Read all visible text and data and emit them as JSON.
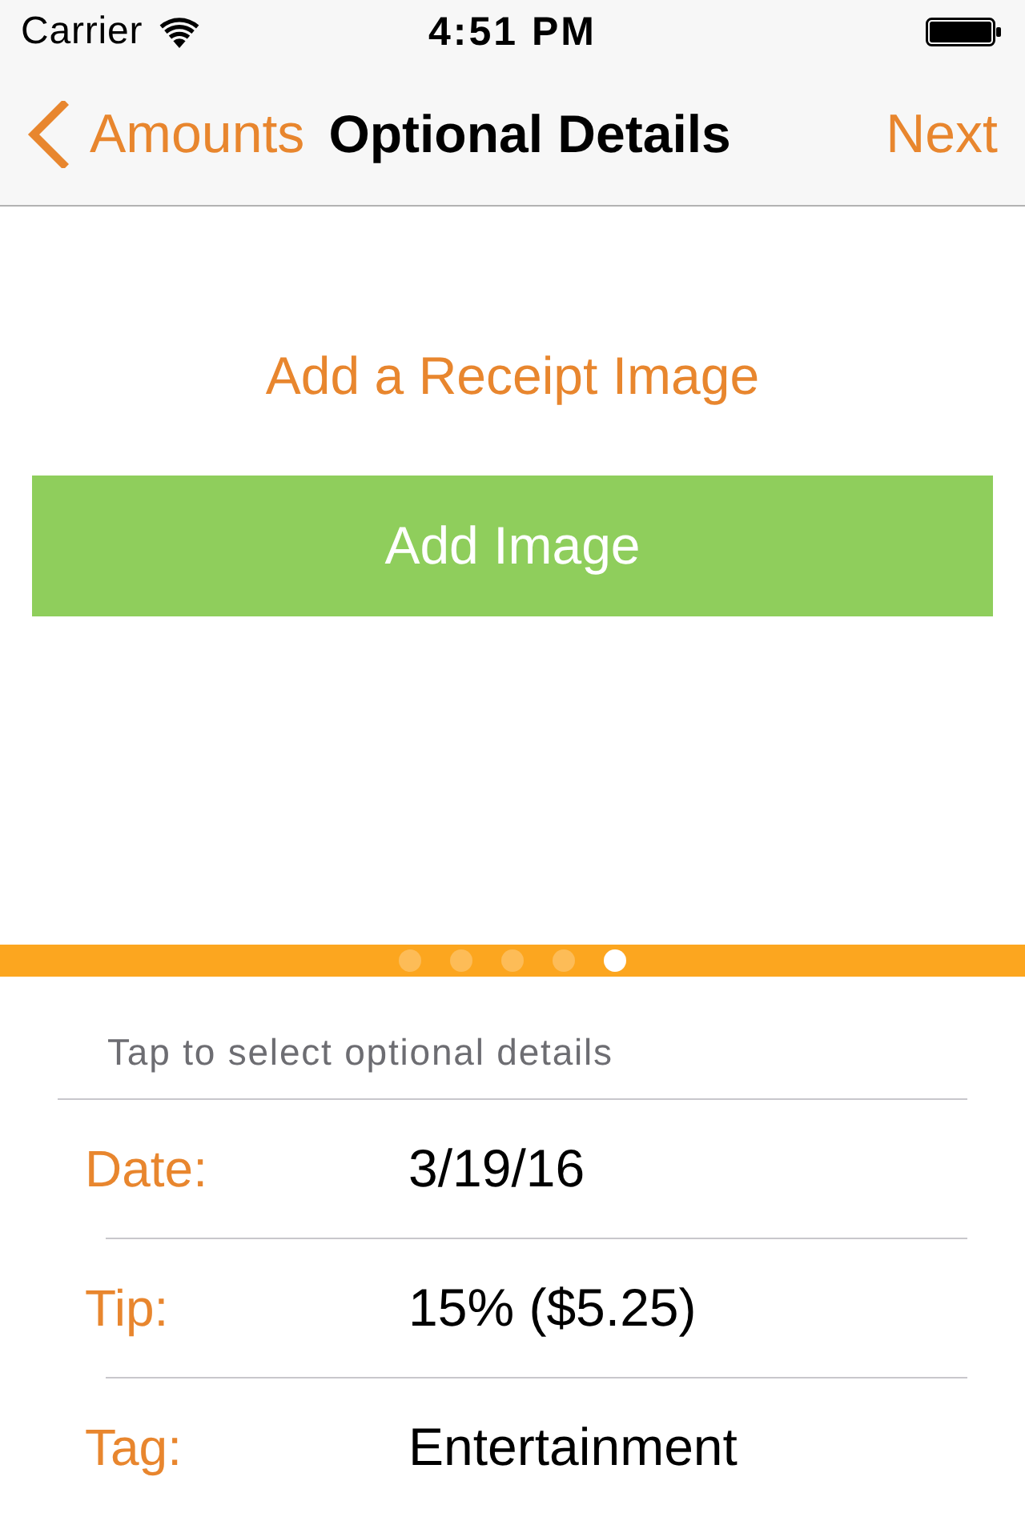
{
  "status_bar": {
    "carrier": "Carrier",
    "time": "4:51 PM"
  },
  "nav_bar": {
    "back": "Amounts",
    "title": "Optional Details",
    "next": "Next"
  },
  "receipt": {
    "heading": "Add a Receipt Image",
    "button": "Add Image"
  },
  "page_control": {
    "pages": [
      {
        "selected": false
      },
      {
        "selected": false
      },
      {
        "selected": false
      },
      {
        "selected": false
      },
      {
        "selected": true
      }
    ]
  },
  "details": {
    "hint": "Tap to select optional details",
    "rows": [
      {
        "label": "Date:",
        "value": "3/19/16"
      },
      {
        "label": "Tip:",
        "value": "15% ($5.25)"
      },
      {
        "label": "Tag:",
        "value": "Entertainment"
      }
    ]
  }
}
